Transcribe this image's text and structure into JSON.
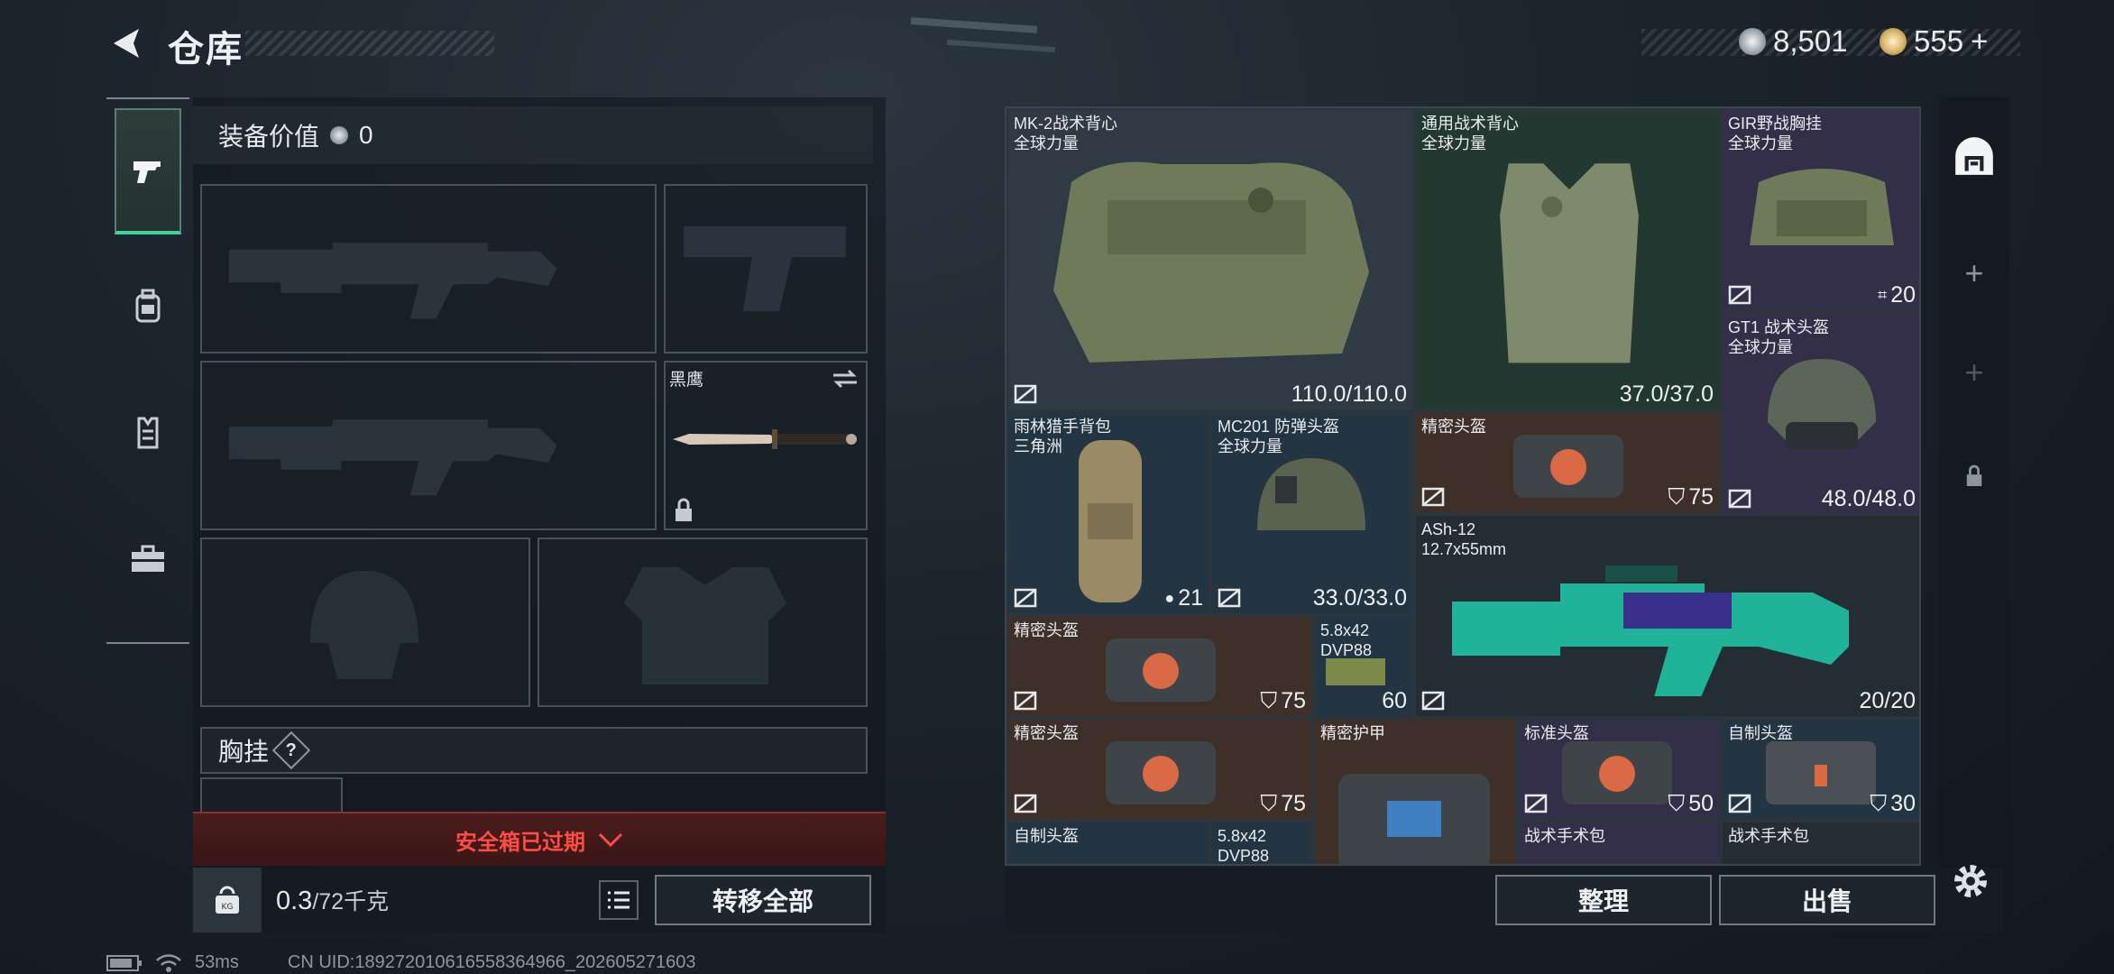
{
  "header": {
    "title": "仓库",
    "currency": [
      {
        "value": "8,501",
        "icon": "silver-coin-icon",
        "color": "#c9cfd4"
      },
      {
        "value": "555",
        "icon": "gold-coin-icon",
        "color": "#d8b46a",
        "suffix": "+"
      }
    ]
  },
  "left": {
    "tabs": [
      {
        "name": "weapon-tab",
        "icon": "pistol-icon",
        "active": true
      },
      {
        "name": "backpack-tab",
        "icon": "backpack-icon",
        "active": false
      },
      {
        "name": "vest-tab",
        "icon": "vest-icon",
        "active": false
      },
      {
        "name": "case-tab",
        "icon": "briefcase-icon",
        "active": false
      }
    ],
    "equip_value_label": "装备价值",
    "equip_value": "0",
    "knife_name": "黑鹰",
    "chest_label": "胸挂",
    "chest_help": "?",
    "safebox_expired": "安全箱已过期",
    "weight_current": "0.3",
    "weight_max": "/72千克",
    "transfer_all": "转移全部"
  },
  "items": [
    {
      "name": "MK-2战术背心",
      "sub": "全球力量",
      "value": "110.0/110.0",
      "bg": "gray"
    },
    {
      "name": "通用战术背心",
      "sub": "全球力量",
      "value": "37.0/37.0",
      "bg": "green"
    },
    {
      "name": "GIR野战胸挂",
      "sub": "全球力量",
      "value": "20",
      "bg": "purple"
    },
    {
      "name": "GT1 战术头盔",
      "sub": "全球力量",
      "value": "48.0/48.0",
      "bg": "purple"
    },
    {
      "name": "雨林猎手背包",
      "sub": "三角洲",
      "value": "21",
      "bg": "blue"
    },
    {
      "name": "MC201 防弹头盔",
      "sub": "全球力量",
      "value": "33.0/33.0",
      "bg": "blue"
    },
    {
      "name": "精密头盔",
      "sub": "",
      "value": "75",
      "bg": "brown"
    },
    {
      "name": "ASh-12",
      "sub": "12.7x55mm",
      "value": "20/20",
      "bg": "dark"
    },
    {
      "name": "精密头盔",
      "sub": "",
      "value": "75",
      "bg": "brown"
    },
    {
      "name": "5.8x42",
      "sub": "DVP88",
      "value": "60",
      "bg": "blue"
    },
    {
      "name": "精密头盔",
      "sub": "",
      "value": "75",
      "bg": "brown"
    },
    {
      "name": "精密护甲",
      "sub": "",
      "value": "",
      "bg": "brown"
    },
    {
      "name": "标准头盔",
      "sub": "",
      "value": "50",
      "bg": "purple"
    },
    {
      "name": "自制头盔",
      "sub": "",
      "value": "30",
      "bg": "blue"
    },
    {
      "name": "自制头盔",
      "sub": "",
      "value": "",
      "bg": "blue"
    },
    {
      "name": "5.8x42",
      "sub": "DVP88",
      "value": "",
      "bg": "blue"
    },
    {
      "name": "战术手术包",
      "sub": "",
      "value": "",
      "bg": "purple"
    },
    {
      "name": "战术手术包",
      "sub": "",
      "value": "",
      "bg": "dark"
    }
  ],
  "actions": {
    "sort": "整理",
    "sell": "出售"
  },
  "status": {
    "ping": "53ms",
    "uid": "CN UID:189272010616558364966_202605271603"
  }
}
